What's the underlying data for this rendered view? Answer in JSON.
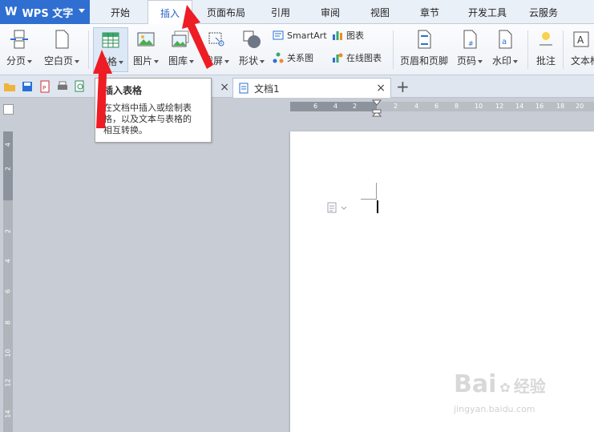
{
  "app": {
    "name": "WPS 文字",
    "accent": "#2f6fd1"
  },
  "menu": {
    "tabs": [
      {
        "label": "开始"
      },
      {
        "label": "插入",
        "active": true
      },
      {
        "label": "页面布局"
      },
      {
        "label": "引用"
      },
      {
        "label": "审阅"
      },
      {
        "label": "视图"
      },
      {
        "label": "章节"
      },
      {
        "label": "开发工具"
      },
      {
        "label": "云服务"
      }
    ]
  },
  "ribbon": {
    "page_break": "分页",
    "blank_page": "空白页",
    "table": "表格",
    "picture": "图片",
    "gallery": "图库",
    "screenshot": "截屏",
    "shape": "形状",
    "smartart": "SmartArt",
    "relation": "关系图",
    "chart": "图表",
    "online_chart": "在线图表",
    "header_footer": "页眉和页脚",
    "page_number": "页码",
    "watermark": "水印",
    "comment": "批注",
    "textbox": "文本框"
  },
  "tabs": {
    "doc": "文档1",
    "add": "+"
  },
  "tooltip": {
    "title": "插入表格",
    "desc_lines": [
      "在文档中插入或绘制表",
      "格，以及文本与表格的",
      "相互转换。"
    ]
  },
  "ruler": {
    "h_ticks": [
      "6",
      "4",
      "2",
      "2",
      "4",
      "6",
      "8",
      "10",
      "12",
      "14",
      "16",
      "18",
      "20"
    ],
    "v_ticks": [
      "4",
      "2",
      "2",
      "4",
      "6",
      "8",
      "10",
      "12",
      "14"
    ]
  },
  "watermark": {
    "text": "Bai",
    "brand": "经验",
    "url": "jingyan.baidu.com"
  }
}
